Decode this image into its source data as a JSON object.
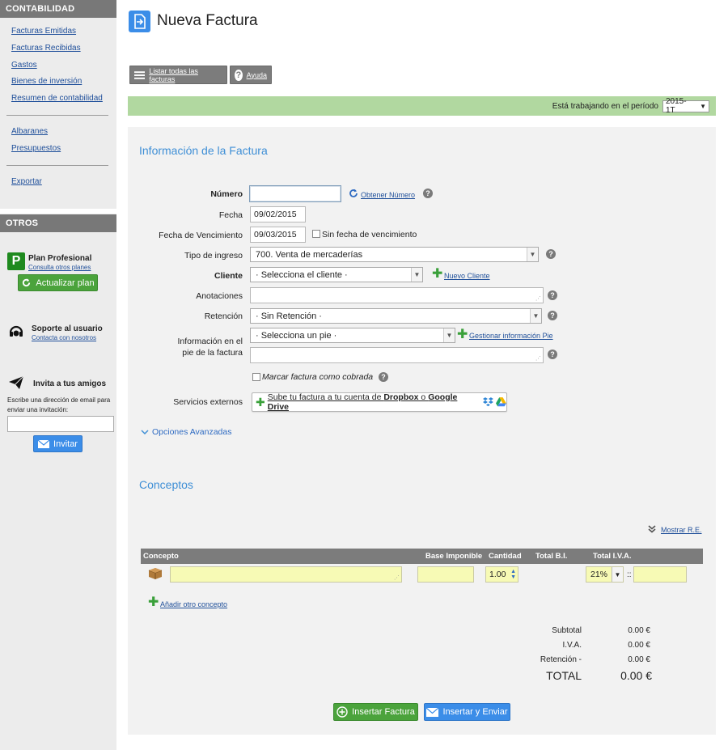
{
  "sidebar": {
    "contabilidad_title": "CONTABILIDAD",
    "contabilidad_links": [
      "Facturas Emitidas",
      "Facturas Recibidas",
      "Gastos",
      "Bienes de inversión",
      "Resumen de contabilidad"
    ],
    "links_2": [
      "Albaranes",
      "Presupuestos"
    ],
    "links_3": [
      "Exportar"
    ],
    "otros_title": "OTROS",
    "plan": {
      "badge": "P",
      "title": "Plan Profesional",
      "subtitle": "Consulta otros planes",
      "button": "Actualizar plan"
    },
    "support": {
      "title": "Soporte al usuario",
      "subtitle": "Contacta con nosotros"
    },
    "invite": {
      "title": "Invita a tus amigos",
      "description": "Escribe una dirección de email para enviar una invitación:",
      "input_value": "",
      "button": "Invitar"
    }
  },
  "header": {
    "title": "Nueva Factura"
  },
  "toolbar": {
    "list_all": "Listar todas las facturas",
    "help": "Ayuda"
  },
  "period": {
    "label": "Está trabajando en el período",
    "value": "2015-1T"
  },
  "invoice_info": {
    "title": "Información de la Factura",
    "numero": {
      "label": "Número",
      "value": "",
      "link": "Obtener Número"
    },
    "fecha": {
      "label": "Fecha",
      "value": "09/02/2015"
    },
    "vencimiento": {
      "label": "Fecha de Vencimiento",
      "value": "09/03/2015",
      "checkbox_label": "Sin fecha de vencimiento"
    },
    "tipo_ingreso": {
      "label": "Tipo de ingreso",
      "value": "700. Venta de mercaderías"
    },
    "cliente": {
      "label": "Cliente",
      "value": "· Selecciona el cliente ·",
      "link": "Nuevo Cliente"
    },
    "anotaciones": {
      "label": "Anotaciones",
      "value": ""
    },
    "retencion": {
      "label": "Retención",
      "value": "· Sin Retención ·"
    },
    "pie": {
      "label_line1": "Información en el",
      "label_line2": "pie de la factura",
      "value": "· Selecciona un pie ·",
      "link": "Gestionar información Pie",
      "text_value": ""
    },
    "cobrada": {
      "label": "Marcar factura como cobrada"
    },
    "servicios": {
      "label": "Servicios externos",
      "button_prefix": "Sube tu factura a tu cuenta de ",
      "dropbox": "Dropbox",
      "o": " o ",
      "drive": "Google Drive"
    },
    "advanced": "Opciones Avanzadas"
  },
  "concepts": {
    "title": "Conceptos",
    "show_re": "Mostrar R.E.",
    "columns": [
      "Concepto",
      "Base Imponible",
      "Cantidad",
      "Total B.I.",
      "Total I.V.A."
    ],
    "row": {
      "concepto": "",
      "base": "",
      "cantidad": "1.00",
      "iva": "21%",
      "sep": "::",
      "total_iva": ""
    },
    "add_link": "Añadir otro concepto"
  },
  "totals": {
    "subtotal_label": "Subtotal",
    "subtotal": "0.00 €",
    "iva_label": "I.V.A.",
    "iva": "0.00 €",
    "retencion_label": "Retención -",
    "retencion": "0.00 €",
    "total_label": "TOTAL",
    "total": "0.00 €"
  },
  "actions": {
    "insert": "Insertar Factura",
    "insert_send": "Insertar y Enviar"
  },
  "colors": {
    "accent_blue": "#3b8de8",
    "green": "#4ba33c",
    "period_bar": "#b1d8a0",
    "title_blue": "#3f8fd6"
  }
}
